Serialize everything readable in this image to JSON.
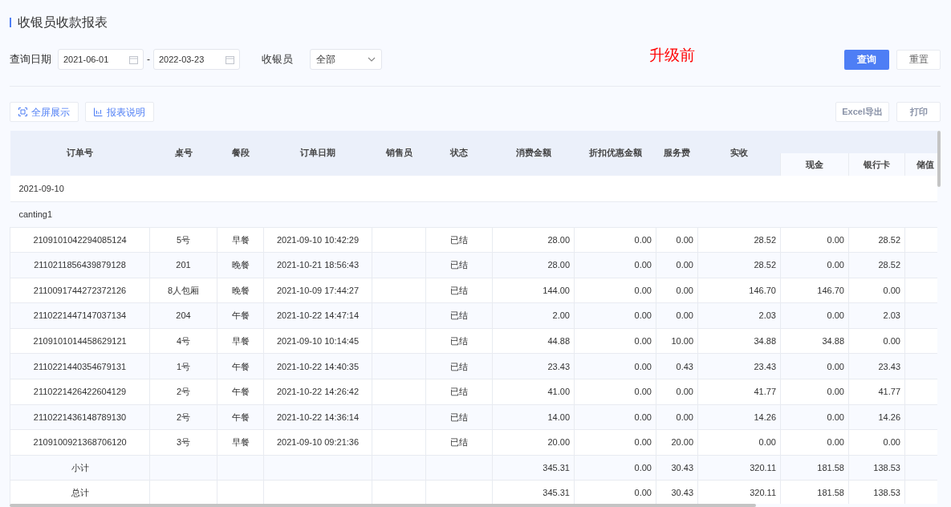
{
  "title": "收银员收款报表",
  "annotation": "升级前",
  "filters": {
    "date_label": "查询日期",
    "date_start": "2021-06-01",
    "date_separator": "-",
    "date_end": "2022-03-23",
    "cashier_label": "收银员",
    "cashier_value": "全部"
  },
  "query_buttons": [
    {
      "label": "查询",
      "kind": "primary"
    },
    {
      "label": "重置",
      "kind": "default"
    }
  ],
  "tool_buttons": [
    "全屏展示",
    "报表说明"
  ],
  "export_buttons": [
    "Excel导出",
    "打印"
  ],
  "table": {
    "columns": [
      "订单号",
      "桌号",
      "餐段",
      "订单日期",
      "销售员",
      "状态",
      "消费金额",
      "折扣优惠金额",
      "服务费",
      "实收"
    ],
    "subcolumns": [
      "现金",
      "银行卡",
      "储值"
    ],
    "rows": [
      {
        "kind": "group",
        "label": "2021-09-10"
      },
      {
        "kind": "group",
        "label": "canting1"
      },
      {
        "kind": "data",
        "cells": [
          "2109101042294085124",
          "5号",
          "早餐",
          "2021-09-10 10:42:29",
          "",
          "已结",
          "28.00",
          "0.00",
          "0.00",
          "28.52",
          "0.00",
          "28.52",
          ""
        ]
      },
      {
        "kind": "data",
        "cells": [
          "2110211856439879128",
          "201",
          "晚餐",
          "2021-10-21 18:56:43",
          "",
          "已结",
          "28.00",
          "0.00",
          "0.00",
          "28.52",
          "0.00",
          "28.52",
          ""
        ]
      },
      {
        "kind": "data",
        "cells": [
          "2110091744272372126",
          "8人包厢",
          "晚餐",
          "2021-10-09 17:44:27",
          "",
          "已结",
          "144.00",
          "0.00",
          "0.00",
          "146.70",
          "146.70",
          "0.00",
          ""
        ]
      },
      {
        "kind": "data",
        "cells": [
          "2110221447147037134",
          "204",
          "午餐",
          "2021-10-22 14:47:14",
          "",
          "已结",
          "2.00",
          "0.00",
          "0.00",
          "2.03",
          "0.00",
          "2.03",
          ""
        ]
      },
      {
        "kind": "data",
        "cells": [
          "2109101014458629121",
          "4号",
          "早餐",
          "2021-09-10 10:14:45",
          "",
          "已结",
          "44.88",
          "0.00",
          "10.00",
          "34.88",
          "34.88",
          "0.00",
          ""
        ]
      },
      {
        "kind": "data",
        "cells": [
          "2110221440354679131",
          "1号",
          "午餐",
          "2021-10-22 14:40:35",
          "",
          "已结",
          "23.43",
          "0.00",
          "0.43",
          "23.43",
          "0.00",
          "23.43",
          ""
        ]
      },
      {
        "kind": "data",
        "cells": [
          "2110221426422604129",
          "2号",
          "午餐",
          "2021-10-22 14:26:42",
          "",
          "已结",
          "41.00",
          "0.00",
          "0.00",
          "41.77",
          "0.00",
          "41.77",
          ""
        ]
      },
      {
        "kind": "data",
        "cells": [
          "2110221436148789130",
          "2号",
          "午餐",
          "2021-10-22 14:36:14",
          "",
          "已结",
          "14.00",
          "0.00",
          "0.00",
          "14.26",
          "0.00",
          "14.26",
          ""
        ]
      },
      {
        "kind": "data",
        "cells": [
          "2109100921368706120",
          "3号",
          "早餐",
          "2021-09-10 09:21:36",
          "",
          "已结",
          "20.00",
          "0.00",
          "20.00",
          "0.00",
          "0.00",
          "0.00",
          ""
        ]
      },
      {
        "kind": "total",
        "cells": [
          "小计",
          "",
          "",
          "",
          "",
          "",
          "345.31",
          "0.00",
          "30.43",
          "320.11",
          "181.58",
          "138.53",
          ""
        ]
      },
      {
        "kind": "total",
        "cells": [
          "总计",
          "",
          "",
          "",
          "",
          "",
          "345.31",
          "0.00",
          "30.43",
          "320.11",
          "181.58",
          "138.53",
          ""
        ]
      }
    ]
  }
}
